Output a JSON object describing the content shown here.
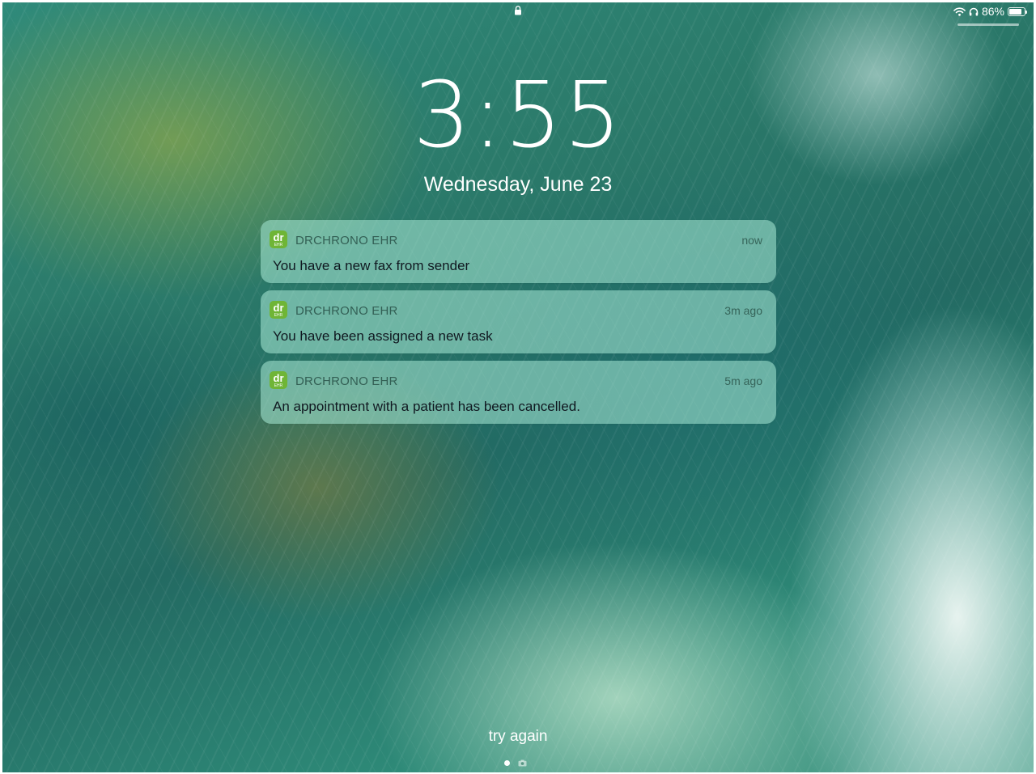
{
  "status_bar": {
    "lock_icon": "lock-icon",
    "wifi_icon": "wifi-icon",
    "headphones_icon": "headphones-icon",
    "battery_percent": "86%",
    "battery_level": 0.86
  },
  "lock_screen": {
    "time": "3:55",
    "date": "Wednesday, June 23",
    "footer_text": "try again"
  },
  "notifications": [
    {
      "app_icon_label": "dr",
      "app_icon_sub": "EHR",
      "app_name": "DRCHRONO EHR",
      "time": "now",
      "message": "You have a new fax from sender"
    },
    {
      "app_icon_label": "dr",
      "app_icon_sub": "EHR",
      "app_name": "DRCHRONO EHR",
      "time": "3m ago",
      "message": "You have been assigned a new task"
    },
    {
      "app_icon_label": "dr",
      "app_icon_sub": "EHR",
      "app_name": "DRCHRONO EHR",
      "time": "5m ago",
      "message": "An appointment with a patient has been cancelled."
    }
  ],
  "page_indicator": {
    "dot_icon": "page-dot-icon",
    "camera_icon": "camera-icon"
  },
  "colors": {
    "app_icon_bg": "#6fb536",
    "text_primary": "#ffffff"
  }
}
